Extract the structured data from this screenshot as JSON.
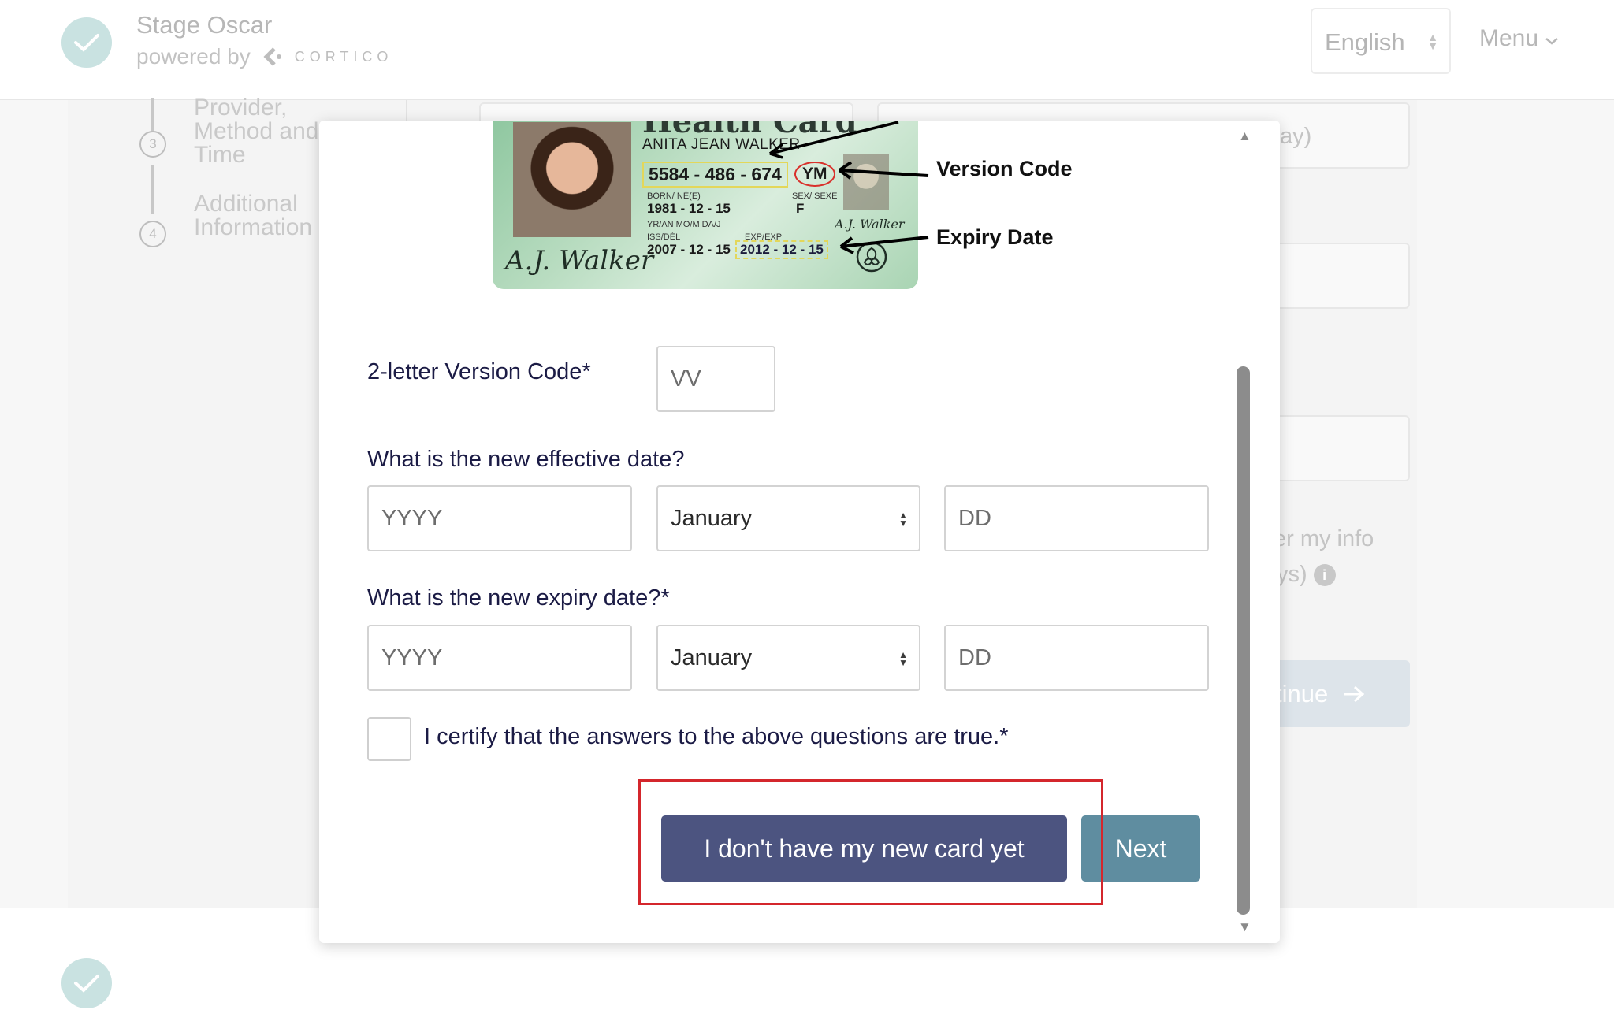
{
  "app": {
    "title": "Stage Oscar",
    "powered_by": "powered by",
    "provider_name": "CORTICO",
    "language": "English",
    "menu_label": "Menu"
  },
  "steps": [
    {
      "number": "3",
      "label": "Provider,\nMethod and\nTime"
    },
    {
      "number": "4",
      "label": "Additional\nInformation"
    }
  ],
  "background": {
    "partial_field_text": "ay)",
    "partial_checkbox_line1": "er my info",
    "partial_checkbox_line2": "ys)",
    "partial_button": "tinue"
  },
  "card": {
    "heading": "Health Card",
    "name": "ANITA JEAN WALKER",
    "number": "5584 - 486 - 674",
    "version": "YM",
    "born_label": "BORN/ NÉ(E)",
    "born": "1981 - 12 - 15",
    "sex_label": "SEX/ SEXE",
    "sex": "F",
    "ymd_label": "YR/AN   MO/M   DA/J",
    "iss_label": "ISS/DÉL",
    "issued": "2007 - 12 - 15",
    "exp_label": "EXP/EXP",
    "expiry": "2012 - 12 - 15",
    "signature": "A.J. Walker",
    "version_code_callout": "Version Code",
    "expiry_date_callout": "Expiry Date"
  },
  "form": {
    "version_code_label": "2-letter Version Code*",
    "version_code_placeholder": "VV",
    "effective_date_label": "What is the new effective date?",
    "expiry_date_label": "What is the new expiry date?*",
    "year_placeholder": "YYYY",
    "month_selected": "January",
    "day_placeholder": "DD",
    "certify_label": "I certify that the answers to the above questions are true.*"
  },
  "buttons": {
    "no_card": "I don't have my new card yet",
    "next": "Next"
  },
  "colors": {
    "primary_button": "#4c5480",
    "next_button": "#5f8da0",
    "highlight": "#d4262c",
    "accent_check": "#c9e2e1"
  }
}
